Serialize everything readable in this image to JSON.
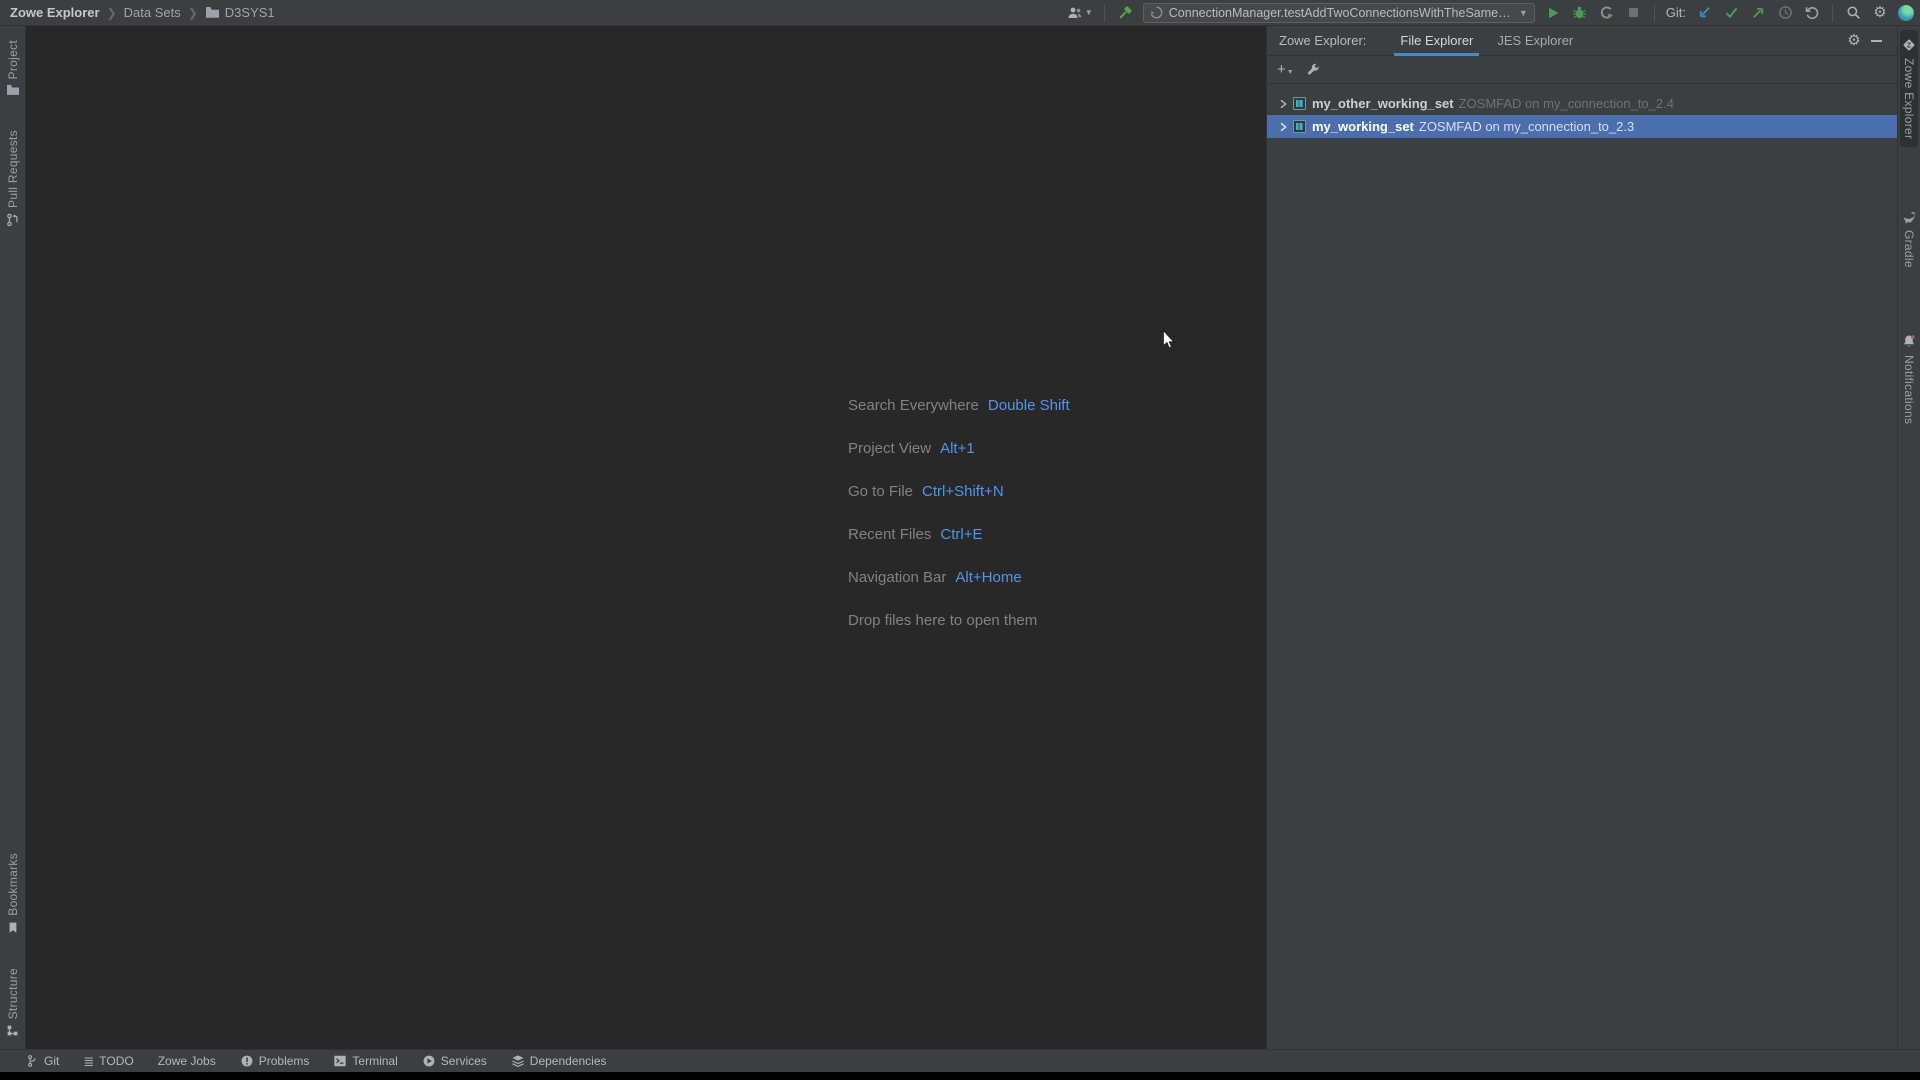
{
  "topbar": {
    "breadcrumbs": {
      "root": "Zowe Explorer",
      "level1": "Data Sets",
      "level2": "D3SYS1"
    },
    "run_config": "ConnectionManager.testAddTwoConnectionsWithTheSameName",
    "git_label": "Git:"
  },
  "panel": {
    "title": "Zowe Explorer:",
    "tabs": {
      "file": "File Explorer",
      "jes": "JES Explorer"
    },
    "tree": [
      {
        "name": "my_other_working_set",
        "detail": "ZOSMFAD on my_connection_to_2.4"
      },
      {
        "name": "my_working_set",
        "detail": "ZOSMFAD on my_connection_to_2.3"
      }
    ]
  },
  "editor": {
    "shortcuts": [
      {
        "label": "Search Everywhere",
        "keys": "Double Shift"
      },
      {
        "label": "Project View",
        "keys": "Alt+1"
      },
      {
        "label": "Go to File",
        "keys": "Ctrl+Shift+N"
      },
      {
        "label": "Recent Files",
        "keys": "Ctrl+E"
      },
      {
        "label": "Navigation Bar",
        "keys": "Alt+Home"
      }
    ],
    "drop_hint": "Drop files here to open them"
  },
  "left_stripe": {
    "project": "Project",
    "pull_requests": "Pull Requests",
    "bookmarks": "Bookmarks",
    "structure": "Structure"
  },
  "right_stripe": {
    "zowe": "Zowe Explorer",
    "gradle": "Gradle",
    "notifications": "Notifications"
  },
  "statusbar": {
    "git": "Git",
    "todo": "TODO",
    "zowe_jobs": "Zowe Jobs",
    "problems": "Problems",
    "terminal": "Terminal",
    "services": "Services",
    "dependencies": "Dependencies"
  },
  "colors": {
    "selection_blue": "#4B6EAF",
    "shortcut_blue": "#5394EC",
    "tab_underline_blue": "#4A88C7",
    "run_green": "#499C54",
    "update_blue": "#3592C4",
    "panel_bg": "#3C3F41",
    "editor_bg": "#282828"
  }
}
